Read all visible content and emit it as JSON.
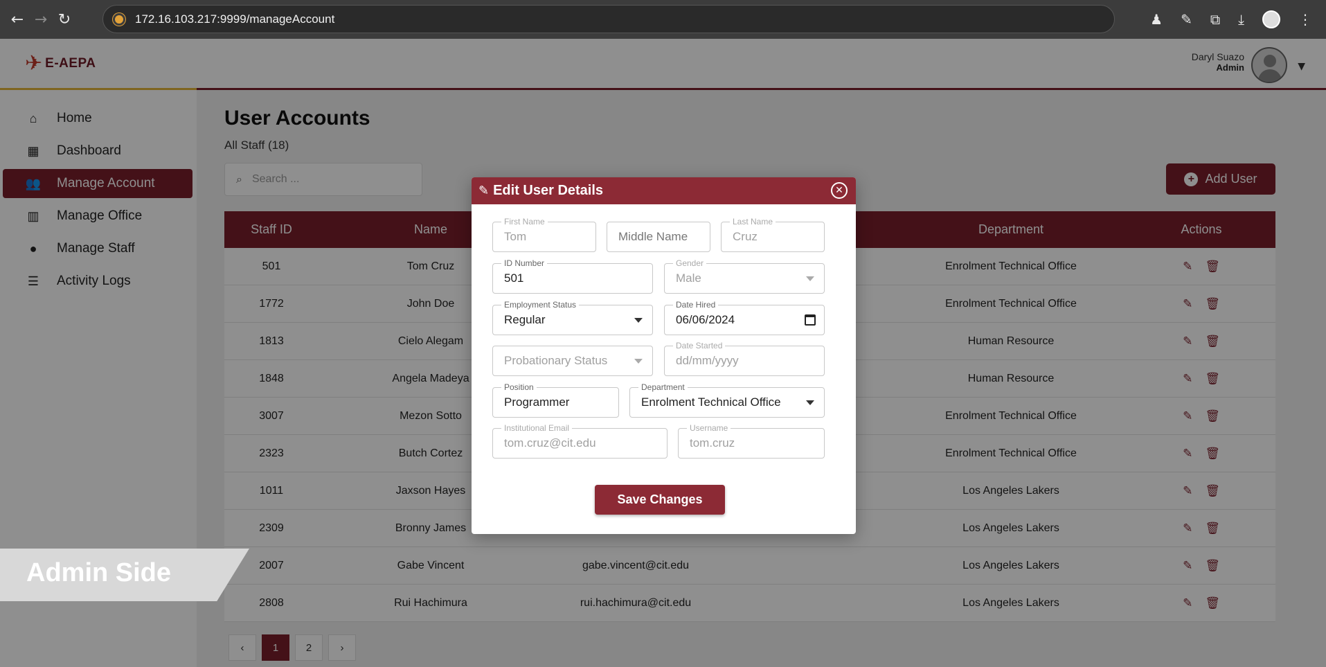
{
  "browser": {
    "url": "172.16.103.217:9999/manageAccount"
  },
  "header": {
    "logo_text": "E-AEPA",
    "user_name": "Daryl Suazo",
    "user_role": "Admin"
  },
  "sidebar": {
    "items": [
      {
        "label": "Home"
      },
      {
        "label": "Dashboard"
      },
      {
        "label": "Manage Account"
      },
      {
        "label": "Manage Office"
      },
      {
        "label": "Manage Staff"
      },
      {
        "label": "Activity Logs"
      }
    ]
  },
  "main": {
    "title": "User Accounts",
    "subtitle": "All Staff (18)",
    "search_placeholder": "Search ...",
    "add_user_label": "Add User",
    "table": {
      "headers": {
        "id": "Staff ID",
        "name": "Name",
        "department": "Department",
        "actions": "Actions"
      },
      "rows": [
        {
          "id": "501",
          "name": "Tom Cruz",
          "email": "",
          "department": "Enrolment Technical Office"
        },
        {
          "id": "1772",
          "name": "John Doe",
          "email": "",
          "department": "Enrolment Technical Office"
        },
        {
          "id": "1813",
          "name": "Cielo Alegam",
          "email": "",
          "department": "Human Resource"
        },
        {
          "id": "1848",
          "name": "Angela Madeya",
          "email": "",
          "department": "Human Resource"
        },
        {
          "id": "3007",
          "name": "Mezon Sotto",
          "email": "",
          "department": "Enrolment Technical Office"
        },
        {
          "id": "2323",
          "name": "Butch Cortez",
          "email": "",
          "department": "Enrolment Technical Office"
        },
        {
          "id": "1011",
          "name": "Jaxson Hayes",
          "email": "",
          "department": "Los Angeles Lakers"
        },
        {
          "id": "2309",
          "name": "Bronny James",
          "email": "",
          "department": "Los Angeles Lakers"
        },
        {
          "id": "2007",
          "name": "Gabe Vincent",
          "email": "gabe.vincent@cit.edu",
          "department": "Los Angeles Lakers"
        },
        {
          "id": "2808",
          "name": "Rui Hachimura",
          "email": "rui.hachimura@cit.edu",
          "department": "Los Angeles Lakers"
        }
      ]
    },
    "pagination": {
      "prev": "‹",
      "pages": [
        "1",
        "2"
      ],
      "next": "›"
    }
  },
  "banner": {
    "text": "Admin Side"
  },
  "modal": {
    "title": "Edit User Details",
    "fields": {
      "first_name": {
        "label": "First Name",
        "value": "Tom"
      },
      "middle_name": {
        "placeholder": "Middle Name"
      },
      "last_name": {
        "label": "Last Name",
        "value": "Cruz"
      },
      "id_number": {
        "label": "ID Number",
        "value": "501"
      },
      "gender": {
        "label": "Gender",
        "value": "Male"
      },
      "employment_status": {
        "label": "Employment Status",
        "value": "Regular"
      },
      "date_hired": {
        "label": "Date Hired",
        "value": "06/06/2024"
      },
      "probationary_status": {
        "placeholder": "Probationary Status"
      },
      "date_started": {
        "label": "Date Started",
        "value": "dd/mm/yyyy"
      },
      "position": {
        "label": "Position",
        "value": "Programmer"
      },
      "department": {
        "label": "Department",
        "value": "Enrolment Technical Office"
      },
      "institutional_email": {
        "label": "Institutional Email",
        "value": "tom.cruz@cit.edu"
      },
      "username": {
        "label": "Username",
        "value": "tom.cruz"
      }
    },
    "save_label": "Save Changes"
  },
  "colors": {
    "primary": "#7a1f2b",
    "modal_header": "#8c2a35",
    "accent_gold": "#e2b53a"
  }
}
